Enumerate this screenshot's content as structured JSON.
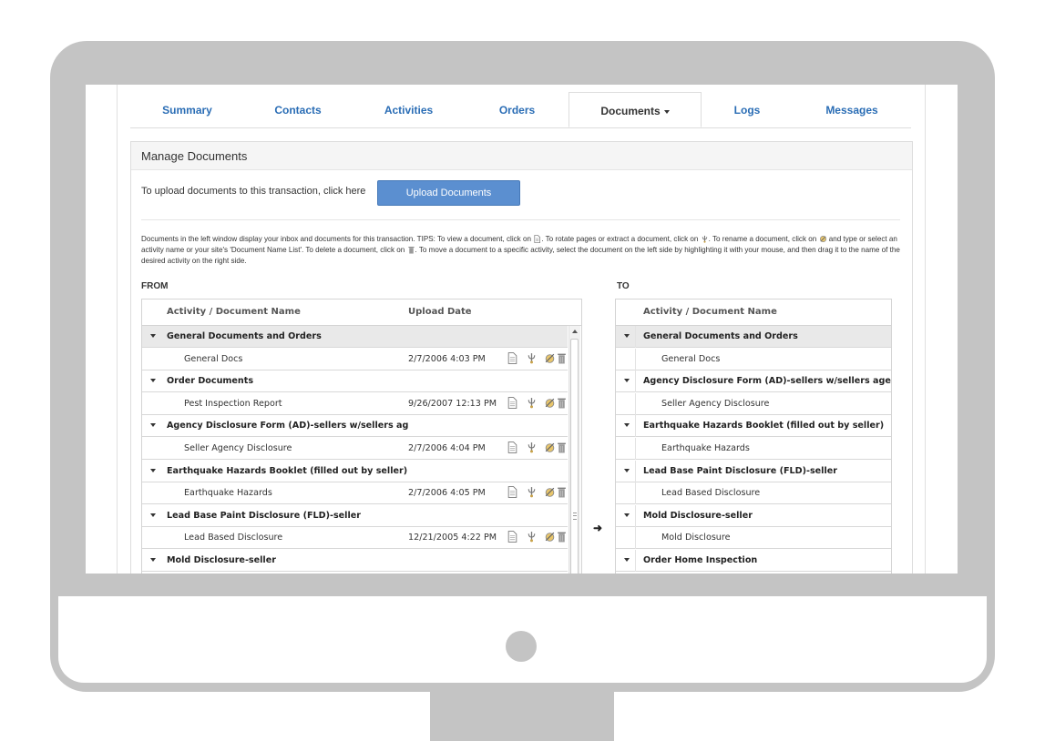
{
  "tabs": {
    "items": [
      {
        "label": "Summary"
      },
      {
        "label": "Contacts"
      },
      {
        "label": "Activities"
      },
      {
        "label": "Orders"
      },
      {
        "label": "Documents"
      },
      {
        "label": "Logs"
      },
      {
        "label": "Messages"
      }
    ],
    "active": "Documents"
  },
  "panel": {
    "title": "Manage Documents",
    "upload_text": "To upload documents to this transaction, click here",
    "upload_button": "Upload Documents",
    "tips": {
      "t1": "Documents in the left window display your inbox and documents for this transaction. TIPS: To view a document, click on ",
      "t2": ". To rotate pages or extract a document, click on ",
      "t3": ". To rename a document, click on ",
      "t4": " and type or select an activity name or your site's 'Document Name List'. To delete a document, click on ",
      "t5": ". To move a document to a specific activity, select the document on the left side by highlighting it with your mouse, and then drag it to the name of the desired activity on the right side."
    },
    "from_label": "FROM",
    "to_label": "TO"
  },
  "from_table": {
    "headers": {
      "name": "Activity / Document Name",
      "date": "Upload Date"
    },
    "rows": [
      {
        "group": "General Documents and Orders"
      },
      {
        "name": "General Docs",
        "date": "2/7/2006 4:03 PM"
      },
      {
        "group": "Order Documents"
      },
      {
        "name": "Pest Inspection Report",
        "date": "9/26/2007 12:13 PM"
      },
      {
        "group": "Agency Disclosure Form (AD)-sellers w/sellers ag"
      },
      {
        "name": "Seller Agency Disclosure",
        "date": "2/7/2006 4:04 PM"
      },
      {
        "group": "Earthquake Hazards Booklet (filled out by seller)"
      },
      {
        "name": "Earthquake Hazards",
        "date": "2/7/2006 4:05 PM"
      },
      {
        "group": "Lead Base Paint Disclosure (FLD)-seller"
      },
      {
        "name": "Lead Based Disclosure",
        "date": "12/21/2005 4:22 PM"
      },
      {
        "group": "Mold Disclosure-seller"
      }
    ]
  },
  "to_table": {
    "headers": {
      "name": "Activity / Document Name"
    },
    "rows": [
      {
        "group": "General Documents and Orders"
      },
      {
        "name": "General Docs"
      },
      {
        "group": "Agency Disclosure Form (AD)-sellers w/sellers agent"
      },
      {
        "name": "Seller Agency Disclosure"
      },
      {
        "group": "Earthquake Hazards Booklet (filled out by seller)"
      },
      {
        "name": "Earthquake Hazards"
      },
      {
        "group": "Lead Base Paint Disclosure (FLD)-seller"
      },
      {
        "name": "Lead Based Disclosure"
      },
      {
        "group": "Mold Disclosure-seller"
      },
      {
        "name": "Mold Disclosure"
      },
      {
        "group": "Order Home Inspection"
      }
    ]
  },
  "icons": {
    "view": "document-icon",
    "rotate": "rotate-extract-icon",
    "rename": "rename-icon",
    "delete": "trash-icon",
    "move": "right-arrow-icon"
  }
}
